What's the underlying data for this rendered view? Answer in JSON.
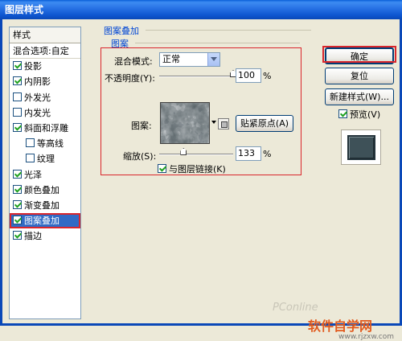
{
  "window": {
    "title": "图层样式"
  },
  "style_list": {
    "header": "样式",
    "blend_options": "混合选项:自定",
    "items": [
      {
        "label": "投影",
        "checked": true,
        "sub": false,
        "selected": false
      },
      {
        "label": "内阴影",
        "checked": true,
        "sub": false,
        "selected": false
      },
      {
        "label": "外发光",
        "checked": false,
        "sub": false,
        "selected": false
      },
      {
        "label": "内发光",
        "checked": false,
        "sub": false,
        "selected": false
      },
      {
        "label": "斜面和浮雕",
        "checked": true,
        "sub": false,
        "selected": false
      },
      {
        "label": "等高线",
        "checked": false,
        "sub": true,
        "selected": false
      },
      {
        "label": "纹理",
        "checked": false,
        "sub": true,
        "selected": false
      },
      {
        "label": "光泽",
        "checked": true,
        "sub": false,
        "selected": false
      },
      {
        "label": "颜色叠加",
        "checked": true,
        "sub": false,
        "selected": false
      },
      {
        "label": "渐变叠加",
        "checked": true,
        "sub": false,
        "selected": false
      },
      {
        "label": "图案叠加",
        "checked": true,
        "sub": false,
        "selected": true
      },
      {
        "label": "描边",
        "checked": true,
        "sub": false,
        "selected": false
      }
    ]
  },
  "pattern_overlay": {
    "group_title": "图案叠加",
    "subgroup_title": "图案",
    "blend_mode_label": "混合模式:",
    "blend_mode_value": "正常",
    "opacity_label": "不透明度(Y):",
    "opacity_value": "100",
    "opacity_unit": "%",
    "opacity_level": 1.0,
    "pattern_label": "图案:",
    "snap_origin_button": "贴紧原点(A)",
    "scale_label": "缩放(S):",
    "scale_value": "133",
    "scale_unit": "%",
    "scale_level": 0.33,
    "link_label": "与图层链接(K)",
    "link_checked": true
  },
  "buttons": {
    "ok": "确定",
    "reset": "复位",
    "new_style": "新建样式(W)...",
    "preview": "预览(V)",
    "preview_checked": true
  },
  "watermark": {
    "pconline": "PConline",
    "logo": "软件自学网",
    "url": "www.rjzxw.com"
  },
  "colors": {
    "titlebar": "#0A5FD8",
    "selection": "#316AC5",
    "highlight_frame": "#D9262C"
  }
}
